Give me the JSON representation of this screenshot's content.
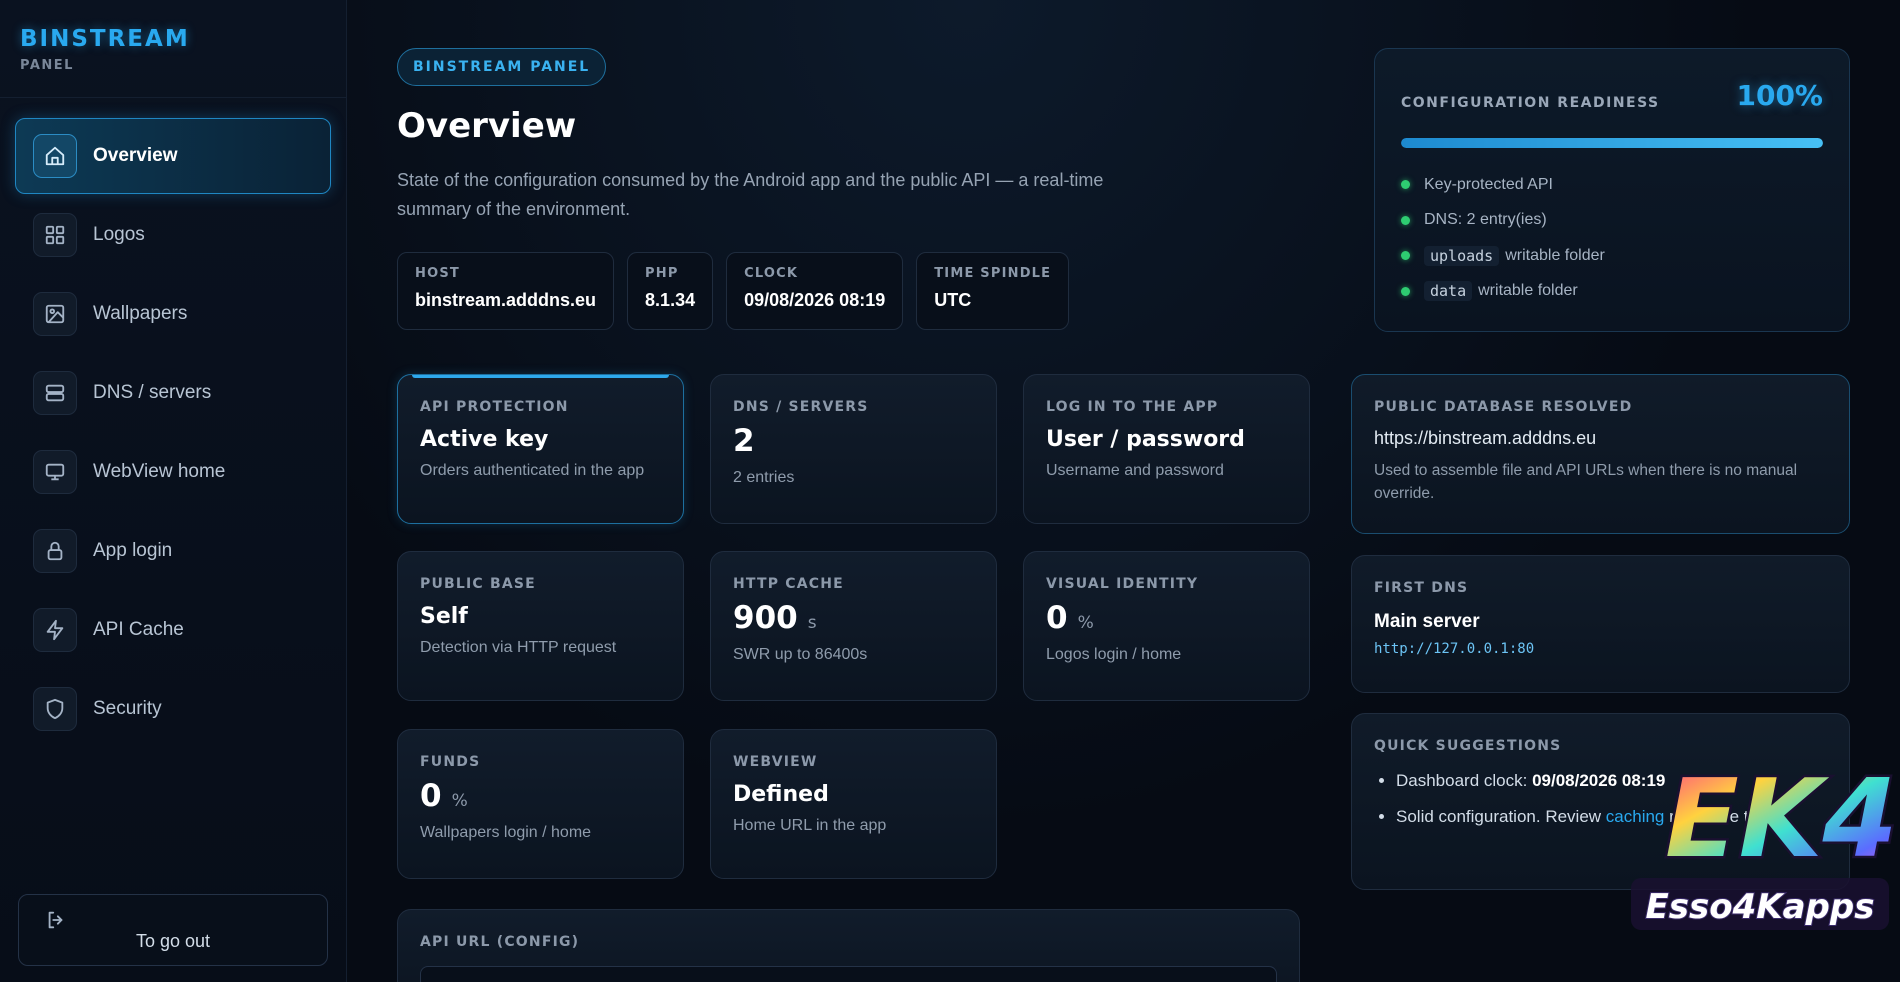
{
  "brand": {
    "title": "BINSTREAM",
    "subtitle": "PANEL"
  },
  "sidebar": {
    "items": [
      {
        "label": "Overview",
        "icon": "home-icon",
        "active": true
      },
      {
        "label": "Logos",
        "icon": "grid-icon"
      },
      {
        "label": "Wallpapers",
        "icon": "image-icon"
      },
      {
        "label": "DNS / servers",
        "icon": "server-icon"
      },
      {
        "label": "WebView home",
        "icon": "monitor-icon"
      },
      {
        "label": "App login",
        "icon": "lock-icon"
      },
      {
        "label": "API Cache",
        "icon": "lightning-icon"
      },
      {
        "label": "Security",
        "icon": "shield-icon"
      }
    ],
    "logout_label": "To go out"
  },
  "header": {
    "badge": "BINSTREAM PANEL",
    "title": "Overview",
    "description": "State of the configuration consumed by the Android app and the public API — a real-time summary of the environment."
  },
  "meta": [
    {
      "key": "HOST",
      "value": "binstream.adddns.eu"
    },
    {
      "key": "PHP",
      "value": "8.1.34"
    },
    {
      "key": "CLOCK",
      "value": "09/08/2026 08:19"
    },
    {
      "key": "TIME SPINDLE",
      "value": "UTC"
    }
  ],
  "readiness": {
    "title": "CONFIGURATION READINESS",
    "percent_label": "100%",
    "percent_value": 100,
    "items": [
      {
        "text": "Key-protected API"
      },
      {
        "text": "DNS: 2 entry(ies)"
      },
      {
        "code": "uploads",
        "text": "writable folder"
      },
      {
        "code": "data",
        "text": "writable folder"
      }
    ]
  },
  "cards": {
    "api_protection": {
      "label": "API PROTECTION",
      "value": "Active key",
      "sub": "Orders authenticated in the app"
    },
    "dns_servers": {
      "label": "DNS / SERVERS",
      "value": "2",
      "sub": "2 entries"
    },
    "login": {
      "label": "LOG IN TO THE APP",
      "value": "User / password",
      "sub": "Username and password"
    },
    "public_base": {
      "label": "PUBLIC BASE",
      "value": "Self",
      "sub": "Detection via HTTP request"
    },
    "http_cache": {
      "label": "HTTP CACHE",
      "value": "900",
      "unit": "s",
      "sub": "SWR up to 86400s"
    },
    "visual_identity": {
      "label": "VISUAL IDENTITY",
      "value": "0",
      "unit": "%",
      "sub": "Logos login / home"
    },
    "funds": {
      "label": "FUNDS",
      "value": "0",
      "unit": "%",
      "sub": "Wallpapers login / home"
    },
    "webview": {
      "label": "WEBVIEW",
      "value": "Defined",
      "sub": "Home URL in the app"
    }
  },
  "side": {
    "public_db": {
      "title": "PUBLIC DATABASE RESOLVED",
      "url": "https://binstream.adddns.eu",
      "desc": "Used to assemble file and API URLs when there is no manual override."
    },
    "first_dns": {
      "title": "FIRST DNS",
      "name": "Main server",
      "address": "http://127.0.0.1:80"
    },
    "suggestions": {
      "title": "QUICK SUGGESTIONS",
      "item1_prefix": "Dashboard clock: ",
      "item1_value": "09/08/2026 08:19",
      "item2_prefix": "Solid configuration. Review ",
      "item2_link": "caching",
      "item2_suffix": " response times."
    }
  },
  "api_url": {
    "label": "API URL (CONFIG)"
  },
  "watermark": {
    "big": "EK4",
    "text": "Esso4Kapps"
  },
  "colors": {
    "accent": "#29a9ef",
    "success": "#2ecc71",
    "background": "#060b14"
  }
}
